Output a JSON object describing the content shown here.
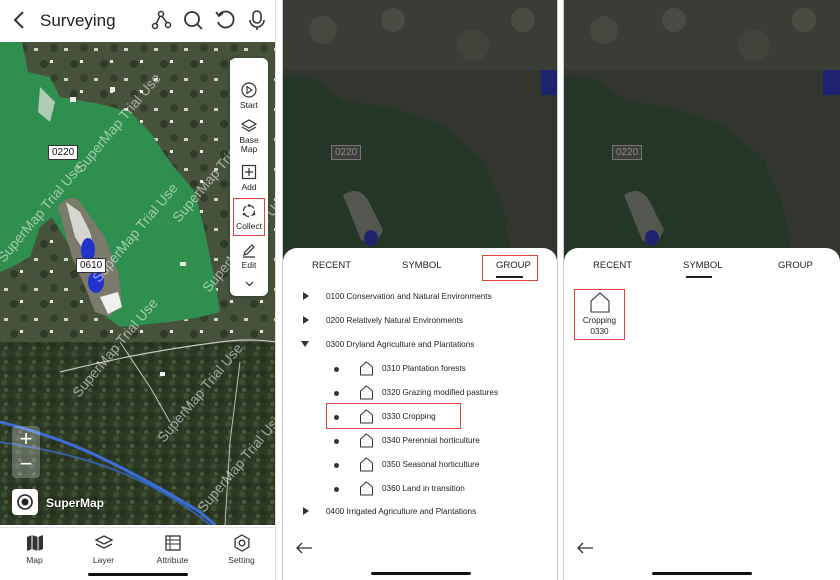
{
  "panel1": {
    "title": "Surveying",
    "parcels": [
      "0220",
      "0610"
    ],
    "watermark": "SuperMap Trial Use",
    "brand": "SuperMap",
    "zoom_in": "+",
    "zoom_out": "−",
    "tools": [
      {
        "label": "Start",
        "icon": "play-icon"
      },
      {
        "label": "Base\nMap",
        "icon": "layers-icon"
      },
      {
        "label": "Add",
        "icon": "plus-square-icon"
      },
      {
        "label": "Collect",
        "icon": "collect-icon"
      },
      {
        "label": "Edit",
        "icon": "pencil-icon"
      }
    ],
    "tabs": [
      {
        "label": "Map",
        "icon": "map-icon"
      },
      {
        "label": "Layer",
        "icon": "layers-icon"
      },
      {
        "label": "Attribute",
        "icon": "table-icon"
      },
      {
        "label": "Setting",
        "icon": "gear-icon"
      }
    ]
  },
  "panel2": {
    "parcel": "0220",
    "tabs": [
      "RECENT",
      "SYMBOL",
      "GROUP"
    ],
    "active_tab": "GROUP",
    "rows": [
      {
        "text": "0100 Conservation and Natural Environments",
        "kind": "collapsed"
      },
      {
        "text": "0200 Relatively Natural Environments",
        "kind": "collapsed"
      },
      {
        "text": "0300 Dryland Agriculture and Plantations",
        "kind": "expanded"
      },
      {
        "text": "0310 Plantation forests",
        "kind": "child"
      },
      {
        "text": "0320  Grazing modified pastures",
        "kind": "child"
      },
      {
        "text": "0330 Cropping",
        "kind": "child",
        "highlighted": true
      },
      {
        "text": "0340 Perennial horticulture",
        "kind": "child"
      },
      {
        "text": "0350 Seasonal horticulture",
        "kind": "child"
      },
      {
        "text": "0360 Land in transition",
        "kind": "child"
      },
      {
        "text": "0400 Irrigated Agriculture and Plantations",
        "kind": "collapsed"
      }
    ]
  },
  "panel3": {
    "parcel": "0220",
    "tabs": [
      "RECENT",
      "SYMBOL",
      "GROUP"
    ],
    "active_tab": "SYMBOL",
    "symbol": {
      "name": "Cropping",
      "code": "0330"
    }
  },
  "colors": {
    "parcel_green": "#2f8f4e",
    "water_blue": "#2233cc",
    "highlight_red": "#e0403a",
    "road_blue": "#3a6fd8"
  }
}
